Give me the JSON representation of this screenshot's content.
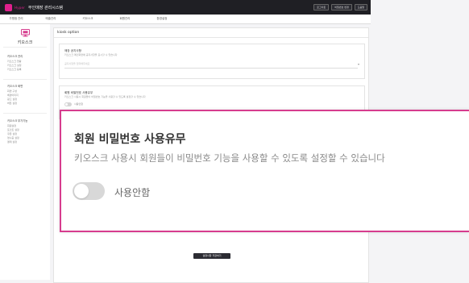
{
  "topbar": {
    "brand_sub": "Hyper",
    "title": "무인매장 관리시스템",
    "actions": [
      "로그아웃",
      "비밀번호 변경",
      "도움말"
    ]
  },
  "menubar": {
    "items": [
      "가맹점 관리",
      "매출관리",
      "키오스크",
      "회원관리",
      "환경설정"
    ]
  },
  "sidebar": {
    "kiosk_label": "키오스크",
    "groups": [
      {
        "head": "키오스크 관리",
        "subs": [
          "키오스크 현황",
          "키오스크 설정",
          "키오스크 등록"
        ]
      },
      {
        "head": "키오스크 화면",
        "subs": [
          "화면 구성",
          "배경이미지",
          "광고 설정",
          "버튼 설정"
        ]
      },
      {
        "head": "키오스크 부가기능",
        "subs": [
          "회원설정",
          "포인트 설정",
          "쿠폰 설정",
          "영수증 설정",
          "결제 설정"
        ]
      }
    ]
  },
  "main": {
    "panel_title": "kiosk option",
    "card1": {
      "title": "매장 공지사항",
      "desc": "키오스크 메인화면에 공지사항을 표시할 수 있습니다",
      "placeholder": "공지사항을 입력해주세요",
      "chevron": "▾"
    },
    "card2": {
      "title": "회원 비밀번호 사용유무",
      "desc": "키오스크 사용시 회원들이 비밀번호 기능을 사용할 수 있도록 설정할 수 있습니다",
      "toggle_label": "사용안함"
    },
    "save_label": "설정사항 저장하기"
  },
  "zoom": {
    "title": "회원 비밀번호 사용유무",
    "desc": "키오스크 사용시 회원들이 비밀번호 기능을 사용할 수 있도록 설정할 수 있습니다",
    "toggle_label": "사용안함",
    "toggle_on": false
  },
  "colors": {
    "accent": "#d63c8e",
    "topbar": "#1f1f24",
    "toggle_off": "#d8d8d8"
  }
}
